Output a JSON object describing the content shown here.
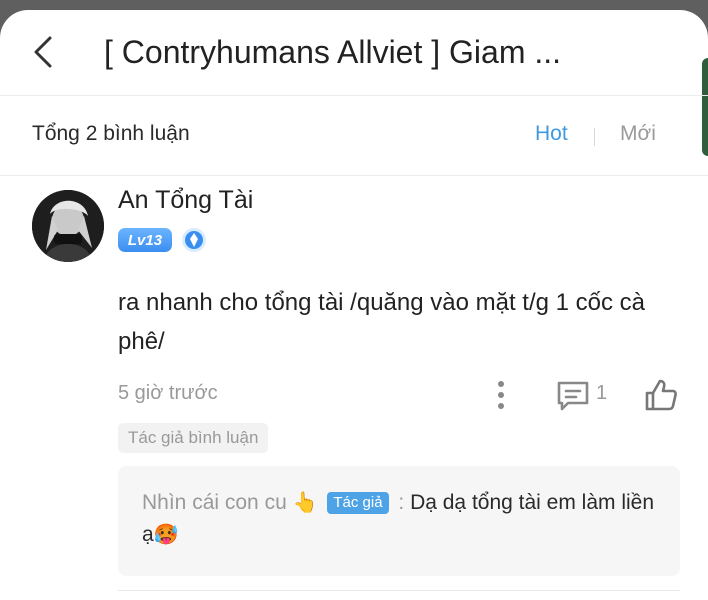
{
  "header": {
    "title": "[ Contryhumans Allviet ] Giam ..."
  },
  "comments_bar": {
    "count_label": "Tổng 2 bình luận",
    "sort_hot": "Hot",
    "sort_new": "Mới",
    "active_color": "#3f9ae0"
  },
  "comment": {
    "username": "An Tổng Tài",
    "level": "Lv13",
    "text": "ra nhanh cho tổng tài /quăng vào mặt t/g 1 cốc cà phê/",
    "time": "5 giờ trước",
    "reply_count": "1",
    "author_tag": "Tác giả bình luận",
    "icons": [
      "avatar",
      "verified-badge-icon",
      "more-icon",
      "reply-icon",
      "like-icon"
    ]
  },
  "reply": {
    "name": "Nhìn cái con cu",
    "name_emoji": "👆",
    "author_badge": "Tác giả",
    "separator": ":",
    "text": "Dạ dạ tổng tài em làm liền ạ",
    "emoji": "🥵"
  }
}
